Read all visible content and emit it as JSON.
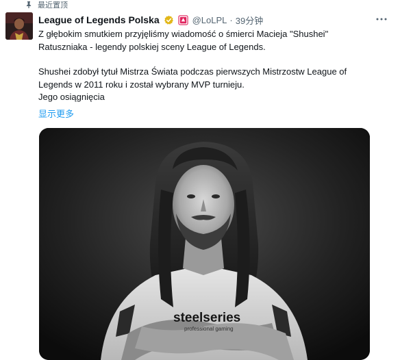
{
  "pinned": {
    "label": "最近置顶",
    "icon": "pin-icon"
  },
  "author": {
    "display_name": "League of Legends Polska",
    "handle": "@LoLPL",
    "separator": "·",
    "timestamp": "39分钟",
    "badges": [
      "verified-gold-badge-icon",
      "affiliate-badge-icon"
    ],
    "avatar": "avatar-photo"
  },
  "tweet": {
    "paragraph1_line1": "Z głębokim smutkiem przyjęliśmy wiadomość o śmierci Macieja \"Shushei\"",
    "paragraph1_line2": "Ratuszniaka - legendy polskiej sceny League of Legends.",
    "paragraph2_line1": "Shushei zdobył tytuł Mistrza Świata podczas pierwszych Mistrzostw League of",
    "paragraph2_line2": "Legends w 2011 roku i został wybrany MVP turnieju.",
    "paragraph2_line3": "Jego osiągnięcia",
    "show_more": "显示更多"
  },
  "media": {
    "description_icon": "photo",
    "shirt_logo_text": "steelseries",
    "shirt_sub_text": "professional gaming"
  },
  "colors": {
    "text_primary": "#0f1419",
    "text_secondary": "#536471",
    "link": "#1d9bf0",
    "verified_gold": "#e2b719",
    "affiliate_red": "#e0245e"
  }
}
